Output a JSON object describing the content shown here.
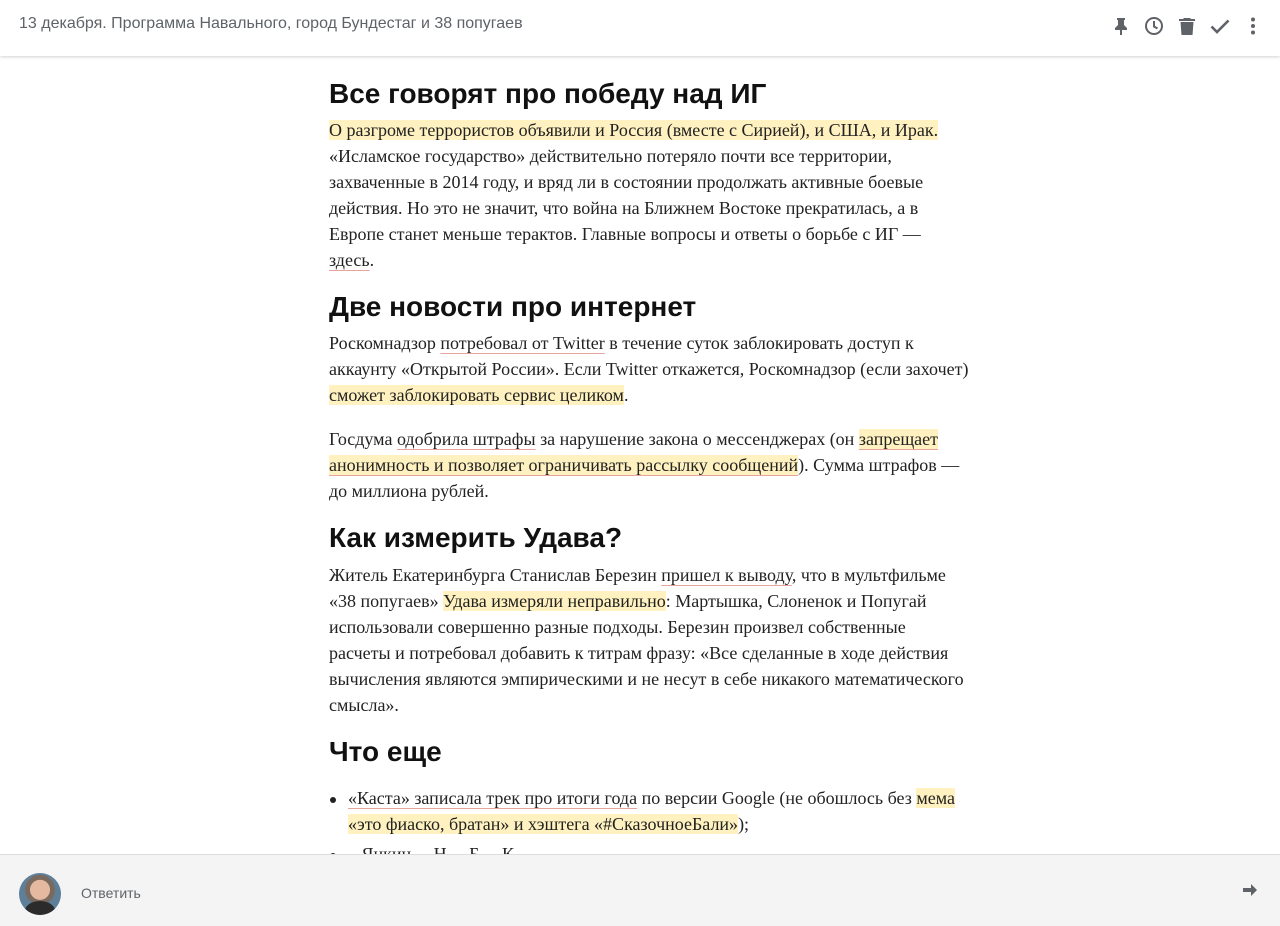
{
  "header": {
    "subject": "13 декабря. Программа Навального, город Бундестаг и 38 попугаев",
    "icons": [
      "pin-icon",
      "snooze-clock-icon",
      "trash-icon",
      "done-check-icon",
      "more-vert-icon"
    ]
  },
  "article": {
    "s1": {
      "heading": "Все говорят про победу над ИГ",
      "hl1": "О разгроме террористов объявили и Россия (вместе с Сирией), и США, и Ирак.",
      "t1": " «Исламское государство» действительно потеряло почти все территории, захваченные в 2014 году, и вряд ли в состоянии продолжать активные боевые действия. Но это не значит, что война на Ближнем Востоке прекратилась, а в Европе станет меньше терактов. Главные вопросы и ответы о борьбе с ИГ — ",
      "link1": "здесь",
      "t2": "."
    },
    "s2": {
      "heading": "Две новости про интернет",
      "a_t1": "Роскомнадзор ",
      "a_link1": "потребовал от Twitter",
      "a_t2": " в течение суток заблокировать доступ к аккаунту «Открытой России». Если Twitter откажется, Роскомнадзор (если захочет) ",
      "a_hl1": "сможет заблокировать сервис целиком",
      "a_t3": ".",
      "b_t1": "Госдума ",
      "b_link1": "одобрила штрафы",
      "b_t2": " за нарушение закона о мессенджерах (он ",
      "b_hl1": "запрещает анонимность и позволяет ограничивать рассылку сообщений",
      "b_t3": "). Сумма штрафов — до миллиона рублей."
    },
    "s3": {
      "heading": "Как измерить Удава?",
      "t1": "Житель Екатеринбурга Станислав Березин ",
      "link1": "пришел к выводу",
      "t2": ", что в мультфильме «38 попугаев» ",
      "hl1": "Удава измеряли неправильно",
      "t3": ": Мартышка, Слоненок и Попугай использовали совершенно разные подходы. Березин произвел собственные расчеты и потребовал добавить к титрам фразу: «Все сделанные в ходе действия вычисления являются эмпирическими и не несут в себе никакого математического смысла»."
    },
    "s4": {
      "heading": "Что еще",
      "item1_link": "«Каста» записала трек про итоги года",
      "item1_t1": " по версии Google (не обошлось без ",
      "item1_hl": "мема «это фиаско, братан» и хэштега «#СказочноеБали»",
      "item1_t2": ");",
      "item2_partial": "...Янкин ... Н ... Б ... К"
    }
  },
  "footer": {
    "reply_label": "Ответить",
    "icons": [
      "avatar",
      "forward-arrow-icon"
    ]
  }
}
